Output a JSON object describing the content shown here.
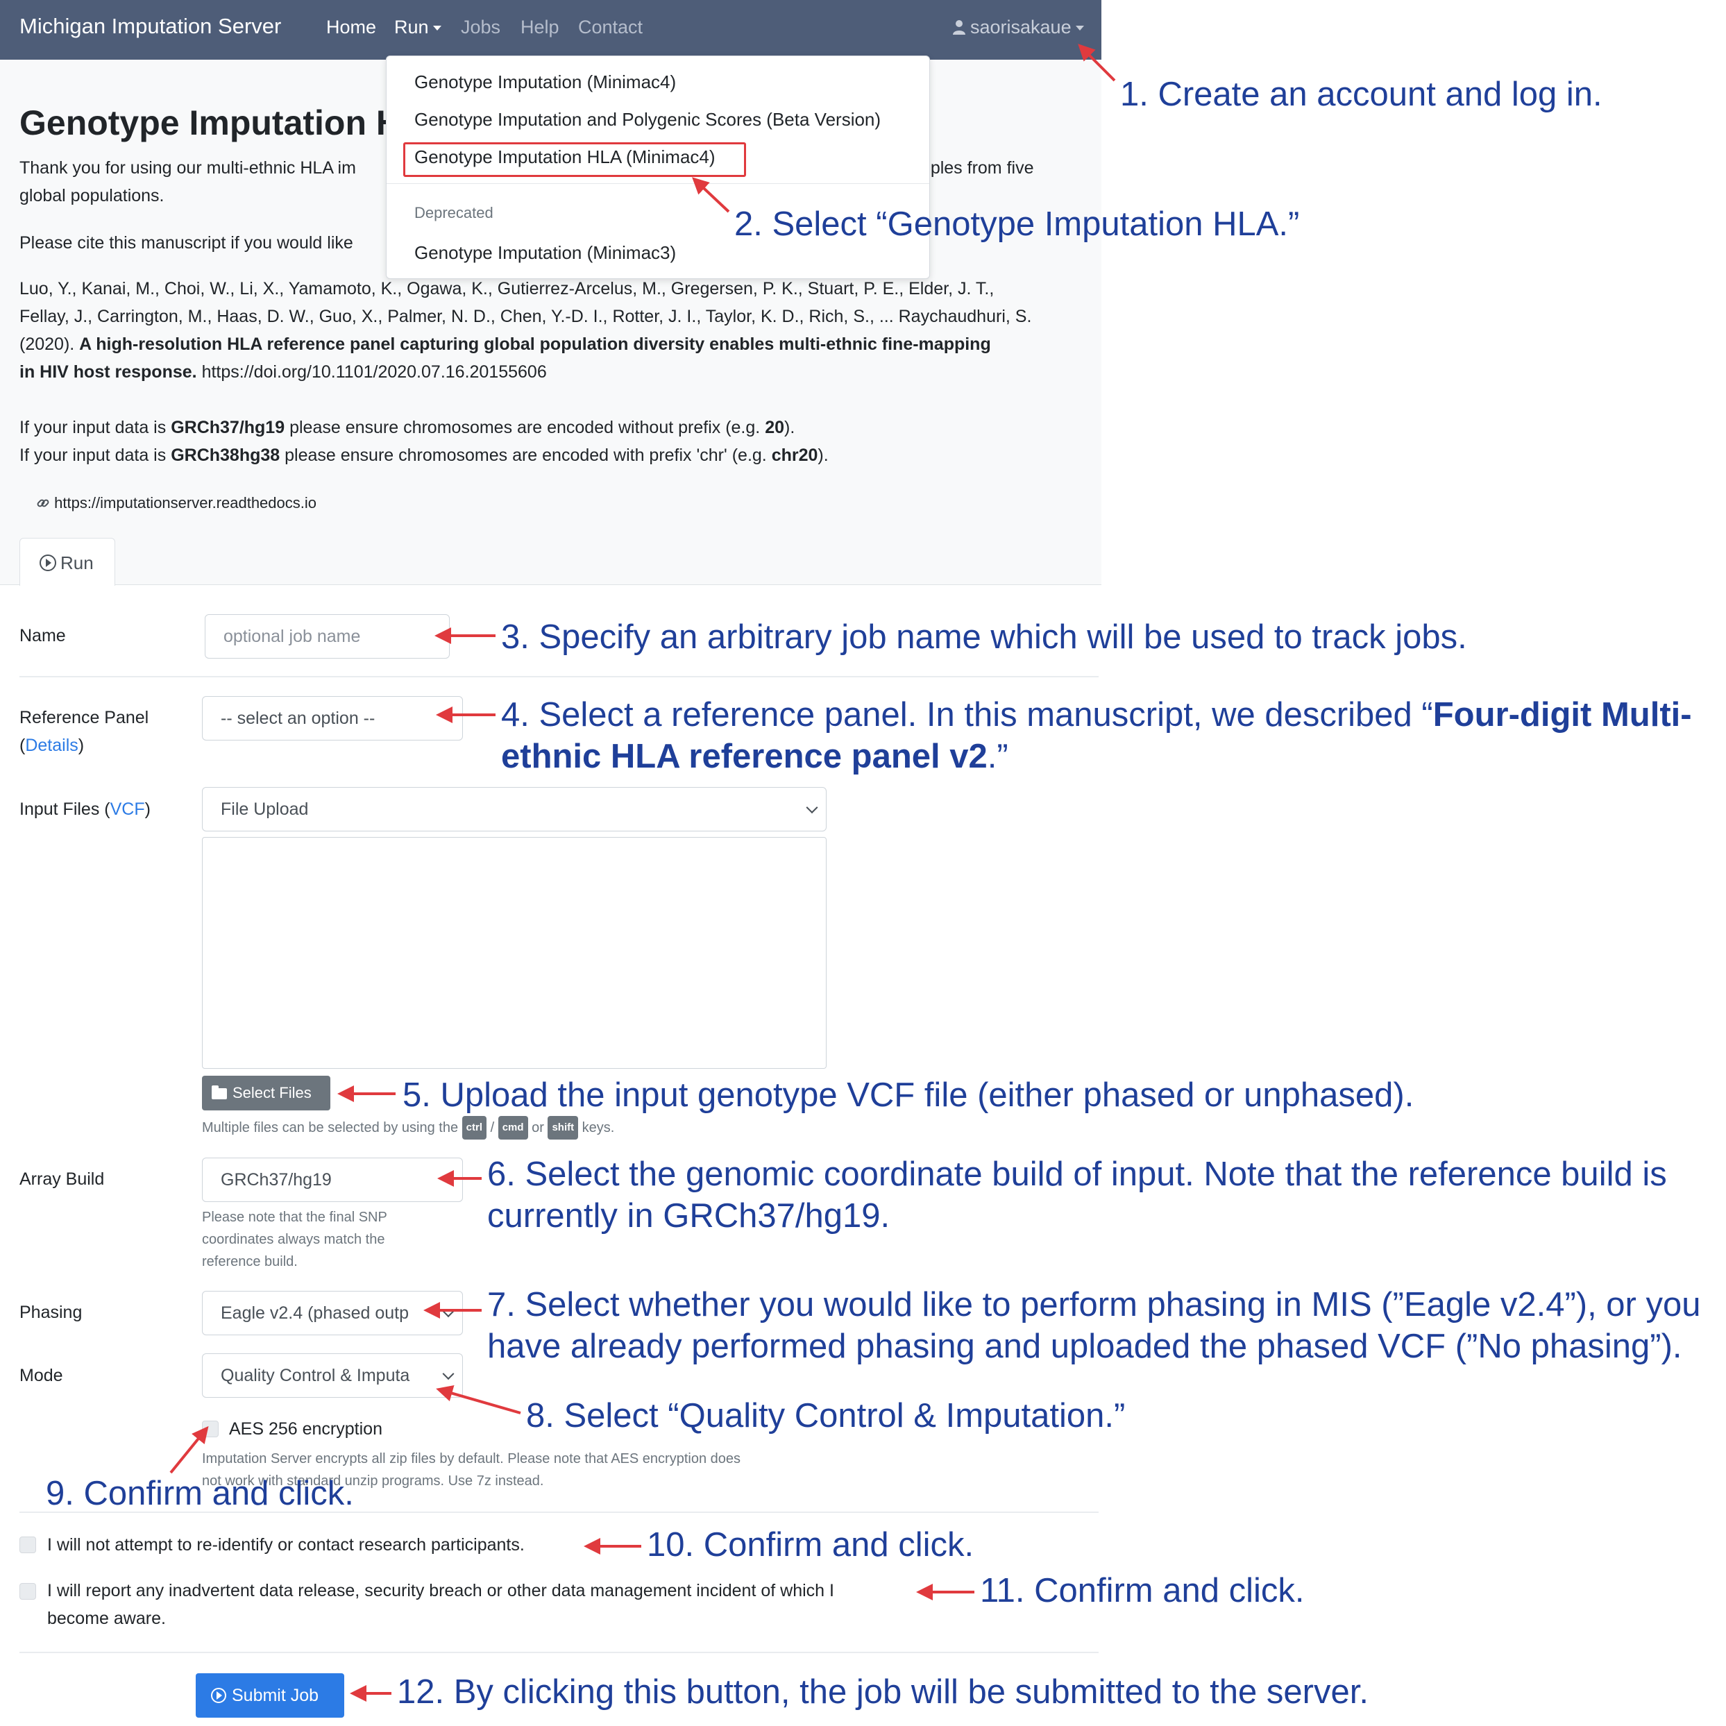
{
  "navbar": {
    "brand": "Michigan Imputation Server",
    "links": [
      "Home",
      "Run",
      "Jobs",
      "Help",
      "Contact"
    ],
    "user": "saorisakaue",
    "user_icon": "user-icon"
  },
  "run_menu": {
    "items": [
      "Genotype Imputation (Minimac4)",
      "Genotype Imputation and Polygenic Scores (Beta Version)",
      "Genotype Imputation HLA (Minimac4)"
    ],
    "deprecated_header": "Deprecated",
    "deprecated_item": "Genotype Imputation (Minimac3)"
  },
  "page": {
    "title": "Genotype Imputation H",
    "intro_part1": "Thank you for using our multi-ethnic HLA im",
    "intro_part2": "mples from five",
    "intro_line2": "global populations.",
    "cite_text": "Please cite this manuscript if you would like",
    "citation_line1": "Luo, Y., Kanai, M., Choi, W., Li, X., Yamamoto, K., Ogawa, K., Gutierrez-Arcelus, M., Gregersen, P. K., Stuart, P. E., Elder, J. T.,",
    "citation_line2": "Fellay, J., Carrington, M., Haas, D. W., Guo, X., Palmer, N. D., Chen, Y.-D. I., Rotter, J. I., Taylor, K. D., Rich, S., ... Raychaudhuri, S.",
    "citation_year": "(2020).",
    "citation_title_line1": "A high-resolution HLA reference panel capturing global population diversity enables multi-ethnic fine-mapping",
    "citation_title_line2": "in HIV host response.",
    "citation_doi": "https://doi.org/10.1101/2020.07.16.20155606",
    "build_note1_a": "If your input data is",
    "build_note1_b": "GRCh37/hg19",
    "build_note1_c": "please ensure chromosomes are encoded without prefix (e.g.",
    "build_note1_d": "20",
    "build_note1_e": ").",
    "build_note2_a": "If your input data is",
    "build_note2_b": "GRCh38hg38",
    "build_note2_c": "please ensure chromosomes are encoded with prefix 'chr' (e.g.",
    "build_note2_d": "chr20",
    "build_note2_e": ").",
    "docs_link": "https://imputationserver.readthedocs.io",
    "tab_run": "Run"
  },
  "form": {
    "name_label": "Name",
    "name_placeholder": "optional job name",
    "ref_label": "Reference Panel",
    "ref_details": "Details",
    "ref_value": "-- select an option --",
    "input_label": "Input Files (",
    "input_vcf": "VCF",
    "input_label_end": ")",
    "input_value": "File Upload",
    "select_files": "Select Files",
    "multi_help_a": "Multiple files can be selected by using the",
    "key_ctrl": "ctrl",
    "key_cmd": "cmd",
    "key_shift": "shift",
    "multi_help_b": "keys.",
    "array_label": "Array Build",
    "array_value": "GRCh37/hg19",
    "array_help1": "Please note that the final SNP",
    "array_help2": "coordinates always match the",
    "array_help3": "reference build.",
    "phasing_label": "Phasing",
    "phasing_value": "Eagle v2.4 (phased outp",
    "mode_label": "Mode",
    "mode_value": "Quality Control & Imputa",
    "aes_label": "AES 256 encryption",
    "aes_help1": "Imputation Server encrypts all zip files by default. Please note that AES encryption does",
    "aes_help2": "not work with standard unzip programs. Use 7z instead.",
    "agree1": "I will not attempt to re-identify or contact research participants.",
    "agree2_line1": "I will report any inadvertent data release, security breach or other data management incident of which I",
    "agree2_line2": "become aware.",
    "submit": "Submit Job"
  },
  "annotations": {
    "a1": "1. Create an account and log in.",
    "a2": "2. Select “Genotype Imputation HLA.”",
    "a3": "3. Specify an arbitrary job name which will be used to track jobs.",
    "a4_line1_a": "4. Select a reference panel. In this manuscript, we described “",
    "a4_line1_b": "Four-digit Multi-",
    "a4_line2_a": "ethnic HLA reference panel v2",
    "a4_line2_b": ".”",
    "a5": "5. Upload the input genotype VCF file (either phased or unphased).",
    "a6_line1": "6. Select the genomic coordinate build of input. Note that the reference build is",
    "a6_line2": "currently in GRCh37/hg19.",
    "a7_line1": "7. Select whether you would like to perform phasing in MIS (”Eagle v2.4”), or you",
    "a7_line2": "have already performed phasing and uploaded the phased VCF (”No phasing”).",
    "a8": "8. Select “Quality Control & Imputation.”",
    "a9": "9. Confirm and click.",
    "a10": "10. Confirm and click.",
    "a11": "11. Confirm and click.",
    "a12": "12. By clicking this button, the job will be submitted to the server."
  },
  "colors": {
    "navbar": "#4e5d78",
    "annotation_text": "#1f3f99",
    "arrow": "#e03a3e",
    "primary": "#2c7be5"
  }
}
